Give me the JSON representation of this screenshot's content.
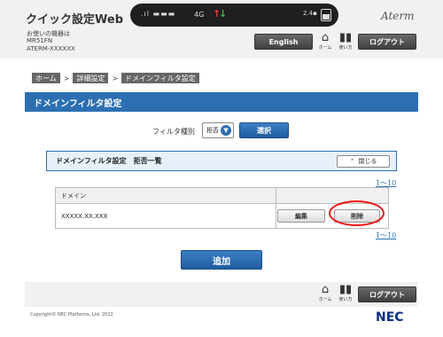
{
  "header": {
    "app_title": "クイック設定Web",
    "device_label": "お使いの機器は",
    "model": "MR51FN",
    "ssid": "ATERM-XXXXXX",
    "brand": "Aterm",
    "status": {
      "network": "4G"
    },
    "english_label": "English",
    "home_label": "ホーム",
    "help_label": "使い方",
    "logout_label": "ログアウト"
  },
  "breadcrumb": [
    "ホーム",
    "詳細設定",
    "ドメインフィルタ設定"
  ],
  "section": {
    "title": "ドメインフィルタ設定"
  },
  "filter": {
    "label": "フィルタ種別",
    "selected": "拒否",
    "select_button": "選択"
  },
  "list_panel": {
    "title": "ドメインフィルタ設定　拒否一覧",
    "close_label": "閉じる"
  },
  "pager": {
    "top": "1〜10",
    "bottom": "1〜10"
  },
  "table": {
    "column_header": "ドメイン",
    "rows": [
      {
        "domain": "XXXXX.XX.XXX",
        "edit_label": "編集",
        "delete_label": "削除"
      }
    ]
  },
  "add_button": "追加",
  "footer": {
    "home_label": "ホーム",
    "help_label": "使い方",
    "logout_label": "ログアウト",
    "copyright": "Copyright© NEC Platforms, Ltd. 2022",
    "logo": "NEC"
  },
  "colors": {
    "accent": "#2c6fb1",
    "highlight": "#e11111"
  }
}
